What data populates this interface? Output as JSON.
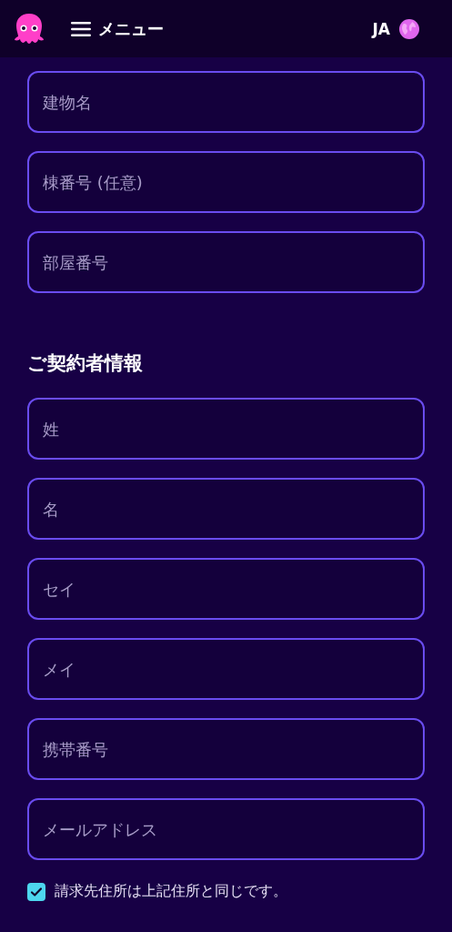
{
  "header": {
    "menu_label": "メニュー",
    "language": "JA"
  },
  "address_fields": [
    {
      "placeholder": "建物名"
    },
    {
      "placeholder": "棟番号 (任意)"
    },
    {
      "placeholder": "部屋番号"
    }
  ],
  "contract_section": {
    "title": "ご契約者情報",
    "fields": [
      {
        "placeholder": "姓"
      },
      {
        "placeholder": "名"
      },
      {
        "placeholder": "セイ"
      },
      {
        "placeholder": "メイ"
      },
      {
        "placeholder": "携帯番号"
      },
      {
        "placeholder": "メールアドレス"
      }
    ]
  },
  "billing_same": {
    "label": "請求先住所は上記住所と同じです。",
    "checked": true
  }
}
